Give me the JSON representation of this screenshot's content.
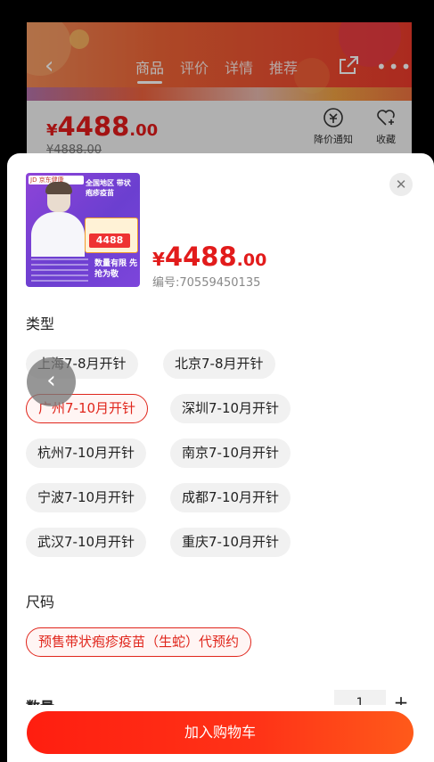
{
  "header": {
    "tabs": [
      {
        "label": "商品",
        "active": true
      },
      {
        "label": "评价",
        "active": false
      },
      {
        "label": "详情",
        "active": false
      },
      {
        "label": "推荐",
        "active": false
      }
    ],
    "back_icon": "chevron-left-icon",
    "share_icon": "share-icon",
    "more_icon": "more-dots-icon"
  },
  "background_product": {
    "price_currency": "¥",
    "price_integer": "4488",
    "price_decimal": ".00",
    "old_price": "¥4888.00",
    "actions": [
      {
        "label": "降价通知",
        "icon": "price-drop-bell-icon"
      },
      {
        "label": "收藏",
        "icon": "heart-plus-icon"
      }
    ]
  },
  "sheet": {
    "thumbnail": {
      "brand": "JD 京东健康",
      "title": "全国地区 带状疱疹疫苗",
      "price_badge": "4488",
      "slogan": "数量有限 先抢为敬"
    },
    "price_currency": "¥",
    "price_integer": "4488",
    "price_decimal": ".00",
    "sku": "编号:70559450135",
    "close_icon": "close-icon",
    "type_title": "类型",
    "type_options": [
      {
        "label": "上海7-8月开针",
        "selected": false
      },
      {
        "label": "北京7-8月开针",
        "selected": false
      },
      {
        "label": "广州7-10月开针",
        "selected": true
      },
      {
        "label": "深圳7-10月开针",
        "selected": false
      },
      {
        "label": "杭州7-10月开针",
        "selected": false
      },
      {
        "label": "南京7-10月开针",
        "selected": false
      },
      {
        "label": "宁波7-10月开针",
        "selected": false
      },
      {
        "label": "成都7-10月开针",
        "selected": false
      },
      {
        "label": "武汉7-10月开针",
        "selected": false
      },
      {
        "label": "重庆7-10月开针",
        "selected": false
      }
    ],
    "size_title": "尺码",
    "size_options": [
      {
        "label": "预售带状疱疹疫苗（生蛇）代预约",
        "selected": true
      }
    ],
    "quantity_label": "数量",
    "quantity_value": "1",
    "quantity_minus": "−",
    "quantity_plus": "+",
    "add_to_cart_label": "加入购物车"
  },
  "floating_back_icon": "chevron-left-icon",
  "colors": {
    "accent": "#e21b1b",
    "cart_gradient_start": "#ff1e10",
    "cart_gradient_end": "#ff5a1a",
    "chip_bg": "#f1f1f1"
  }
}
